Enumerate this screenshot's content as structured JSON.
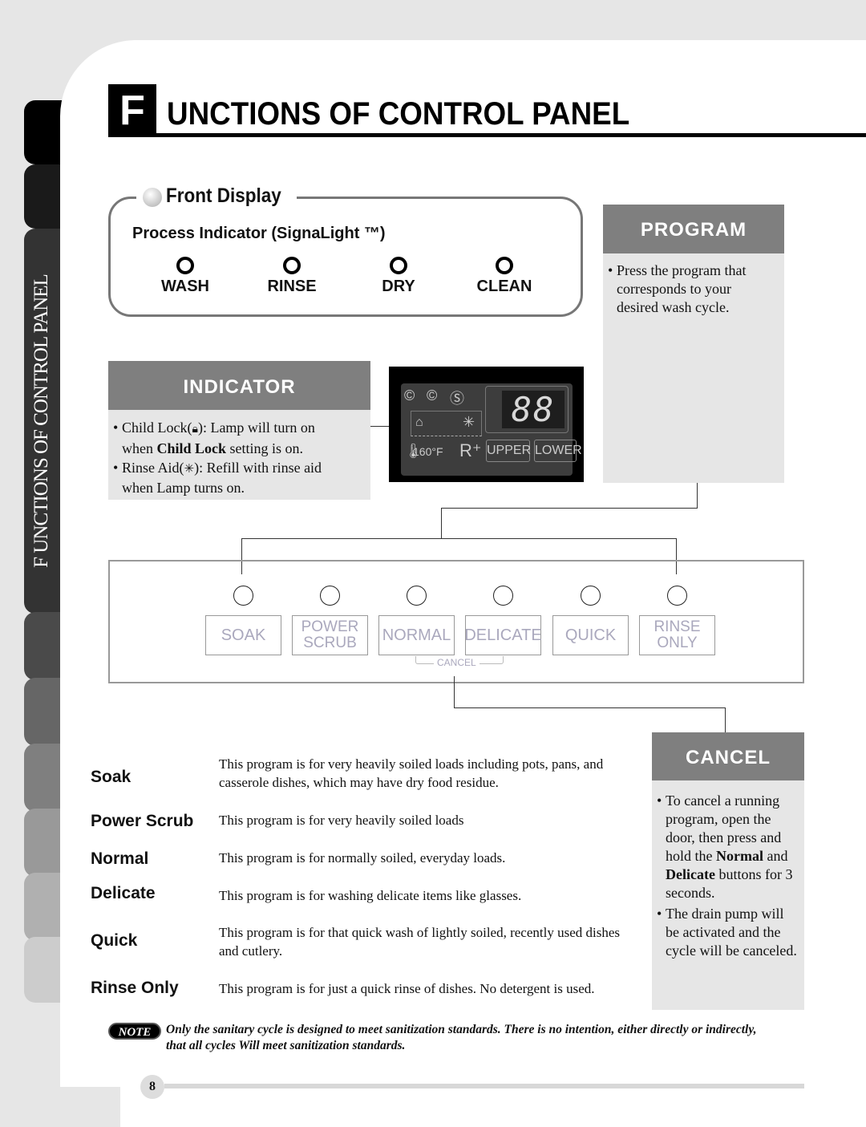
{
  "side_tab": {
    "label": "F UNCTIONS OF CONTROL PANEL"
  },
  "title": {
    "initial": "F",
    "rest": "UNCTIONS OF CONTROL PANEL"
  },
  "front_display": {
    "heading": "Front Display",
    "process_indicator": "Process Indicator (SignaLight ™)",
    "lights": [
      {
        "label": "WASH"
      },
      {
        "label": "RINSE"
      },
      {
        "label": "DRY"
      },
      {
        "label": "CLEAN"
      }
    ]
  },
  "program": {
    "heading": "PROGRAM",
    "bullets": [
      "Press the program that corresponds to your desired wash cycle."
    ]
  },
  "indicator": {
    "heading": "INDICATOR",
    "child_lock": {
      "prefix": "Child Lock(",
      "icon": "🔒",
      "suffix": "): Lamp will turn on",
      "line2_pre": "when ",
      "line2_bold": "Child Lock",
      "line2_post": " setting is on."
    },
    "rinse_aid": {
      "prefix": "Rinse Aid(",
      "icon": "✳",
      "suffix": "): Refill with rinse aid",
      "line2": "when Lamp turns on."
    }
  },
  "lcd": {
    "digits": "88",
    "icons": [
      "wash-spiral-icon",
      "rinse-spiral-icon",
      "dry-spiral-icon",
      "child-lock-icon",
      "rinse-aid-icon",
      "thermometer-icon"
    ],
    "temperature": "160°F",
    "r_plus": "R⁺",
    "upper": "UPPER",
    "lower": "LOWER"
  },
  "control_panel": {
    "buttons": [
      {
        "line1": "SOAK",
        "line2": ""
      },
      {
        "line1": "POWER",
        "line2": "SCRUB"
      },
      {
        "line1": "NORMAL",
        "line2": ""
      },
      {
        "line1": "DELICATE",
        "line2": ""
      },
      {
        "line1": "QUICK",
        "line2": ""
      },
      {
        "line1": "RINSE",
        "line2": "ONLY"
      }
    ],
    "cancel_label": "CANCEL"
  },
  "programs": [
    {
      "name": "Soak",
      "desc": "This program is for very heavily soiled loads including pots, pans, and casserole dishes, which may have dry food residue."
    },
    {
      "name": "Power Scrub",
      "desc": "This program is for very heavily soiled loads"
    },
    {
      "name": "Normal",
      "desc": "This program is for normally soiled, everyday loads."
    },
    {
      "name": "Delicate",
      "desc": "This program is for washing delicate items like glasses."
    },
    {
      "name": "Quick",
      "desc": "This program is for that quick wash of lightly soiled, recently used dishes and cutlery."
    },
    {
      "name": "Rinse Only",
      "desc": "This program is for just a quick rinse of dishes.  No detergent is used."
    }
  ],
  "cancel": {
    "heading": "CANCEL",
    "bullet1": {
      "pre": "To cancel a running program, open the door, then press and hold the ",
      "b1": "Normal",
      "mid": " and ",
      "b2": "Delicate",
      "post": " buttons for 3 seconds."
    },
    "bullet2": "The drain pump will be activated and the cycle will be canceled."
  },
  "note": {
    "badge": "NOTE",
    "text": "Only the sanitary cycle is designed to meet sanitization standards. There is no intention, either directly or indirectly, that all cycles Will meet sanitization standards."
  },
  "footer": {
    "page_number": "8"
  }
}
